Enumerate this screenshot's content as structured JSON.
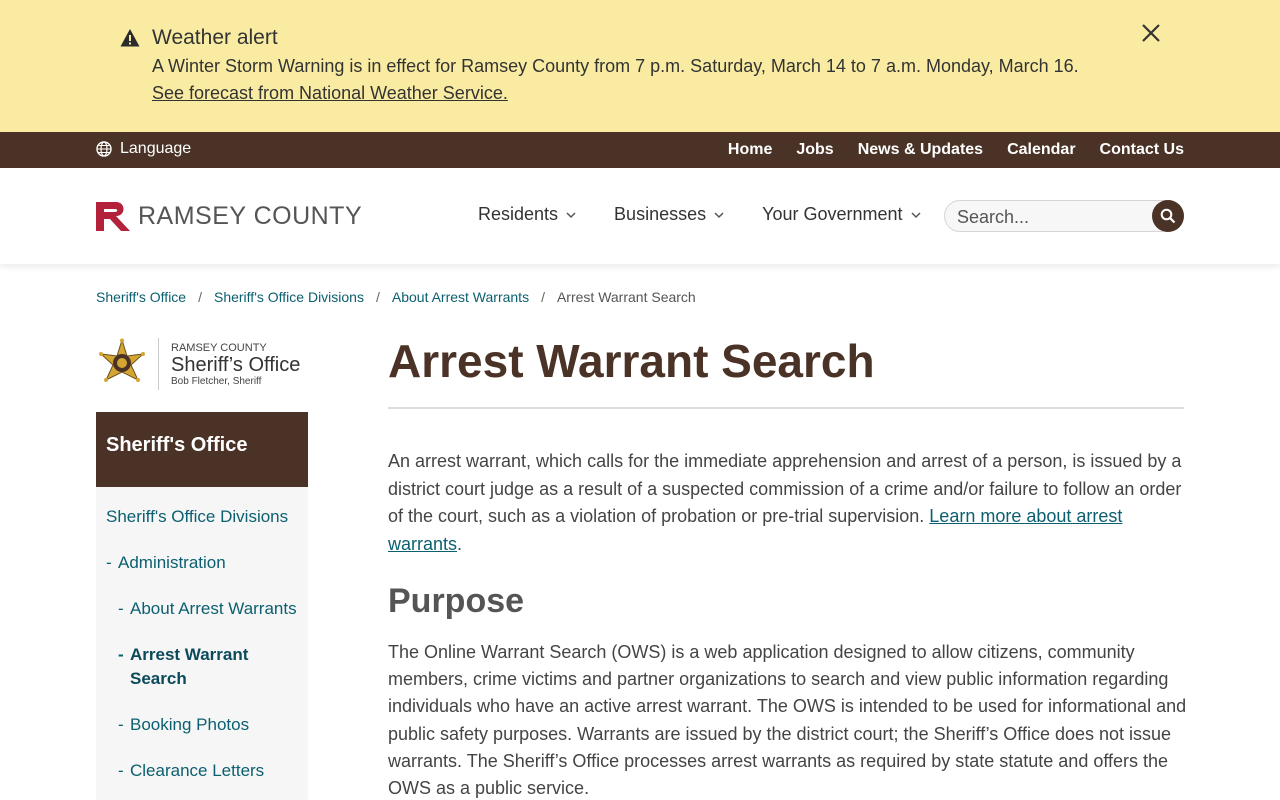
{
  "alert": {
    "title": "Weather alert",
    "text": "A Winter Storm Warning is in effect for Ramsey County from 7 p.m. Saturday, March 14 to 7 a.m. Monday, March 16.",
    "link": "See forecast from National Weather Service.",
    "icon": "warning-triangle-icon"
  },
  "utility": {
    "language": "Language",
    "links": [
      "Home",
      "Jobs",
      "News & Updates",
      "Calendar",
      "Contact Us"
    ]
  },
  "header": {
    "logo_text": "RAMSEY COUNTY",
    "nav": [
      "Residents",
      "Businesses",
      "Your Government"
    ],
    "search_placeholder": "Search..."
  },
  "breadcrumb": {
    "items": [
      "Sheriff's Office",
      "Sheriff's Office Divisions",
      "About Arrest Warrants"
    ],
    "current": "Arrest Warrant Search",
    "separator": "/"
  },
  "sheriff_logo": {
    "small": "RAMSEY COUNTY",
    "big": "Sheriff’s Office",
    "sub": "Bob Fletcher, Sheriff"
  },
  "sidebar": {
    "heading": "Sheriff's Office",
    "items": [
      {
        "label": "Sheriff's Office Divisions"
      },
      {
        "label": "Administration"
      },
      {
        "label": "About Arrest Warrants"
      },
      {
        "label_line1": "Arrest Warrant",
        "label_line2": "Search"
      },
      {
        "label": "Booking Photos"
      },
      {
        "label": "Clearance Letters"
      }
    ]
  },
  "main": {
    "title": "Arrest Warrant Search",
    "intro": "An arrest warrant, which calls for the immediate apprehension and arrest of a person, is issued by a district court judge as a result of a suspected commission of a crime and/or failure to follow an order of the court, such as a violation of probation or pre-trial supervision. ",
    "intro_link": "Learn more about arrest warrants",
    "intro_end": ".",
    "purpose_heading": "Purpose",
    "purpose_text": "The Online Warrant Search (OWS) is a web application designed to allow citizens, community members, crime victims and partner organizations to search and view public information regarding individuals who have an active arrest warrant. The OWS is intended to be used for informational and public safety purposes. Warrants are issued by the district court; the Sheriff’s Office does not issue warrants. The Sheriff’s Office processes arrest warrants as required by state statute and offers the OWS as a public service."
  },
  "colors": {
    "alert_bg": "#f9eca2",
    "brown": "#4a3326",
    "link": "#0b5f70",
    "logo_red": "#b3213a"
  }
}
